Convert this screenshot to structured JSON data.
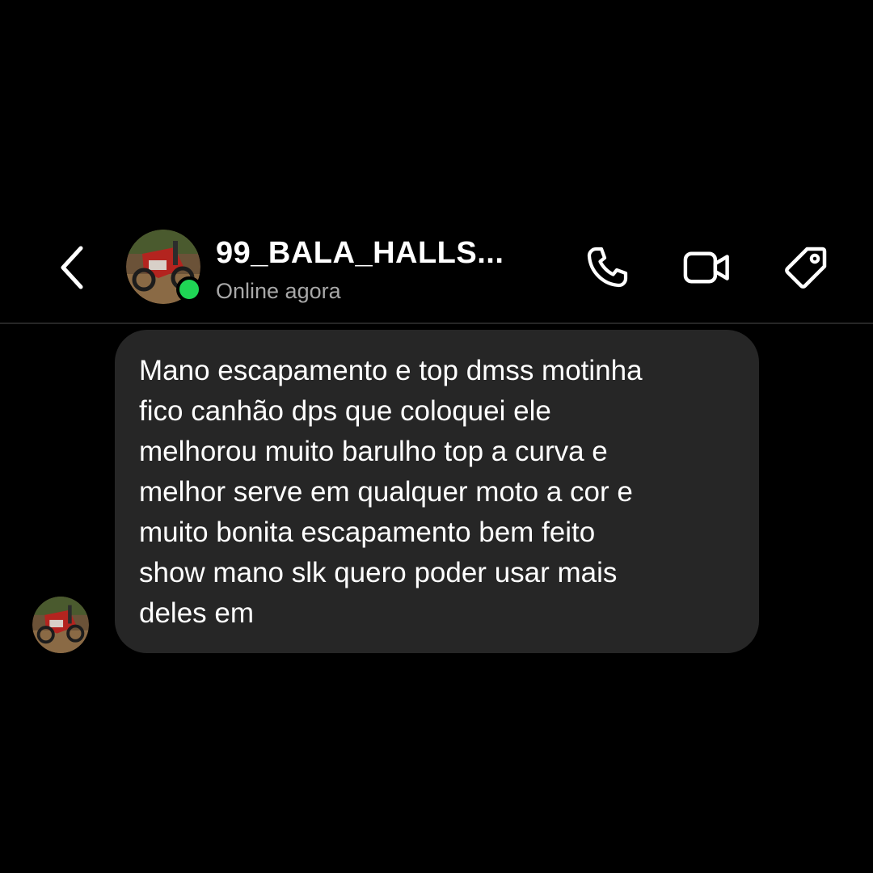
{
  "header": {
    "contact_name": "99_BALA_HALLS...",
    "status": "Online agora",
    "back_icon": "chevron-left-icon",
    "actions": [
      {
        "name": "call",
        "icon": "phone-icon"
      },
      {
        "name": "video",
        "icon": "video-camera-icon"
      },
      {
        "name": "tag",
        "icon": "tag-icon"
      }
    ]
  },
  "colors": {
    "background": "#000000",
    "bubble": "#262626",
    "online_indicator": "#1fd655",
    "status_text": "#a8a8a8"
  },
  "message": {
    "text": "Mano escapamento e top dmss motinha\nfico canhão dps que coloquei ele\nmelhorou muito barulho top a curva e\nmelhor serve em qualquer moto a cor e\nmuito bonita escapamento bem feito\nshow mano slk quero poder usar mais\ndeles em"
  }
}
